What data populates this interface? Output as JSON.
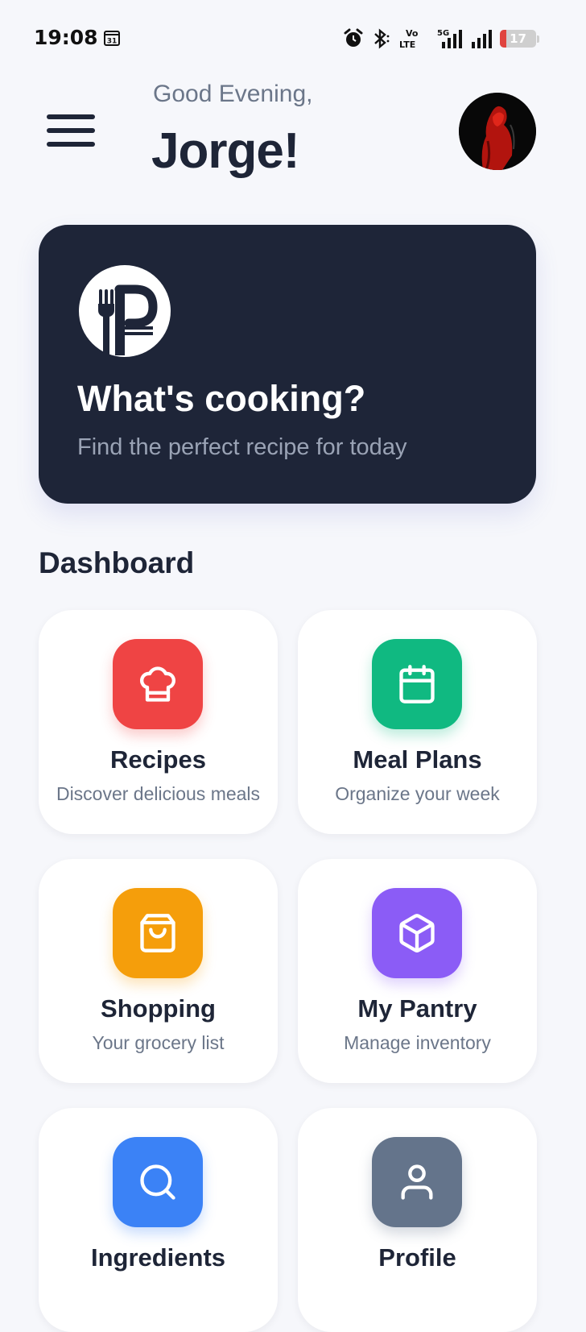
{
  "status_bar": {
    "time": "19:08",
    "calendar_day": "31",
    "network_lte_top": "Vo",
    "network_lte_bottom": "LTE",
    "network_5g": "5G",
    "battery": "17"
  },
  "header": {
    "greeting": "Good Evening,",
    "user_name": "Jorge!"
  },
  "hero": {
    "title": "What's cooking?",
    "subtitle": "Find the perfect recipe for today"
  },
  "dashboard": {
    "title": "Dashboard",
    "tiles": [
      {
        "title": "Recipes",
        "subtitle": "Discover delicious meals",
        "icon": "chef-hat-icon",
        "color": "#ef4444"
      },
      {
        "title": "Meal Plans",
        "subtitle": "Organize your week",
        "icon": "calendar-icon",
        "color": "#10b981"
      },
      {
        "title": "Shopping",
        "subtitle": "Your grocery list",
        "icon": "shopping-bag-icon",
        "color": "#f59e0b"
      },
      {
        "title": "My Pantry",
        "subtitle": "Manage inventory",
        "icon": "box-icon",
        "color": "#8b5cf6"
      },
      {
        "title": "Ingredients",
        "subtitle": "",
        "icon": "search-icon",
        "color": "#3b82f6"
      },
      {
        "title": "Profile",
        "subtitle": "",
        "icon": "user-icon",
        "color": "#64748b"
      }
    ]
  }
}
